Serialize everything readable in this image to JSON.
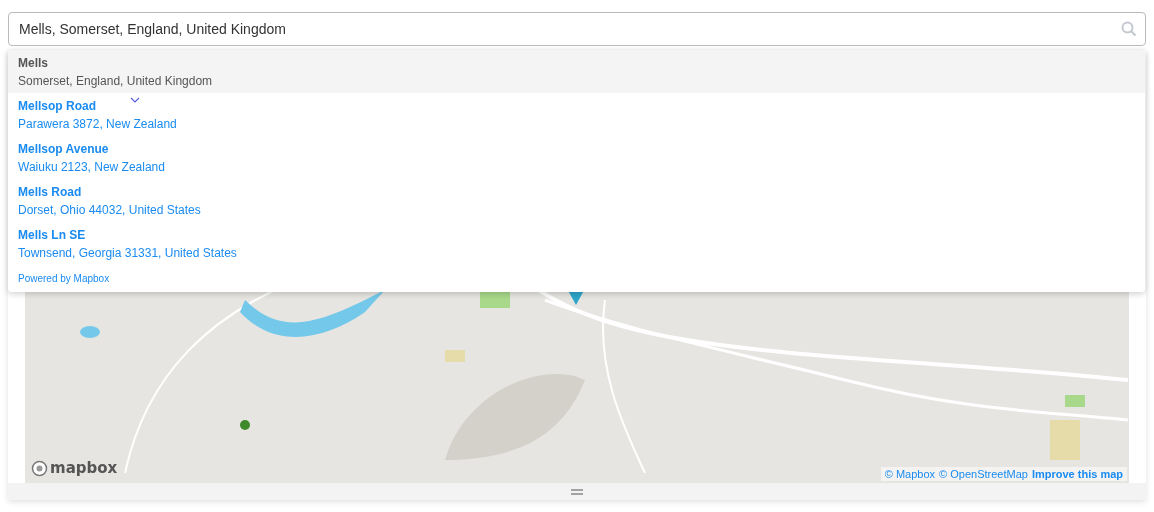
{
  "search": {
    "value": "Mells, Somerset, England, United Kingdom"
  },
  "suggestions": [
    {
      "name": "Mells",
      "address": "Somerset, England, United Kingdom",
      "selected": true
    },
    {
      "name": "Mellsop Road",
      "address": "Parawera 3872, New Zealand",
      "selected": false
    },
    {
      "name": "Mellsop Avenue",
      "address": "Waiuku 2123, New Zealand",
      "selected": false
    },
    {
      "name": "Mells Road",
      "address": "Dorset, Ohio 44032, United States",
      "selected": false
    },
    {
      "name": "Mells Ln SE",
      "address": "Townsend, Georgia 31331, United States",
      "selected": false
    }
  ],
  "powered_by": "Powered by Mapbox",
  "map": {
    "logo": "mapbox",
    "attribution": [
      "© Mapbox",
      "© OpenStreetMap"
    ],
    "improve_link": "Improve this map"
  }
}
